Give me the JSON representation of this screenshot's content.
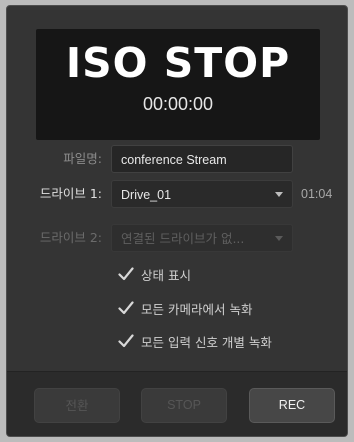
{
  "status": {
    "title": "ISO STOP",
    "timecode": "00:00:00"
  },
  "filename": {
    "label": "파일명:",
    "value": "conference Stream"
  },
  "drive1": {
    "label": "드라이브 1:",
    "selected": "Drive_01",
    "remaining": "01:04"
  },
  "drive2": {
    "label": "드라이브 2:",
    "selected": "연결된 드라이브가 없..."
  },
  "options": [
    {
      "label": "상태 표시",
      "checked": true
    },
    {
      "label": "모든 카메라에서 녹화",
      "checked": true
    },
    {
      "label": "모든 입력 신호 개별 녹화",
      "checked": true
    }
  ],
  "buttons": {
    "cut": "전환",
    "stop": "STOP",
    "rec": "REC"
  },
  "colors": {
    "panel_bg": "#343434",
    "status_bg": "#161616",
    "footer_bg": "#2b2b2b",
    "page_bg": "#bcbcbc"
  },
  "icons": [
    "checkmark-icon",
    "chevron-down-icon"
  ]
}
